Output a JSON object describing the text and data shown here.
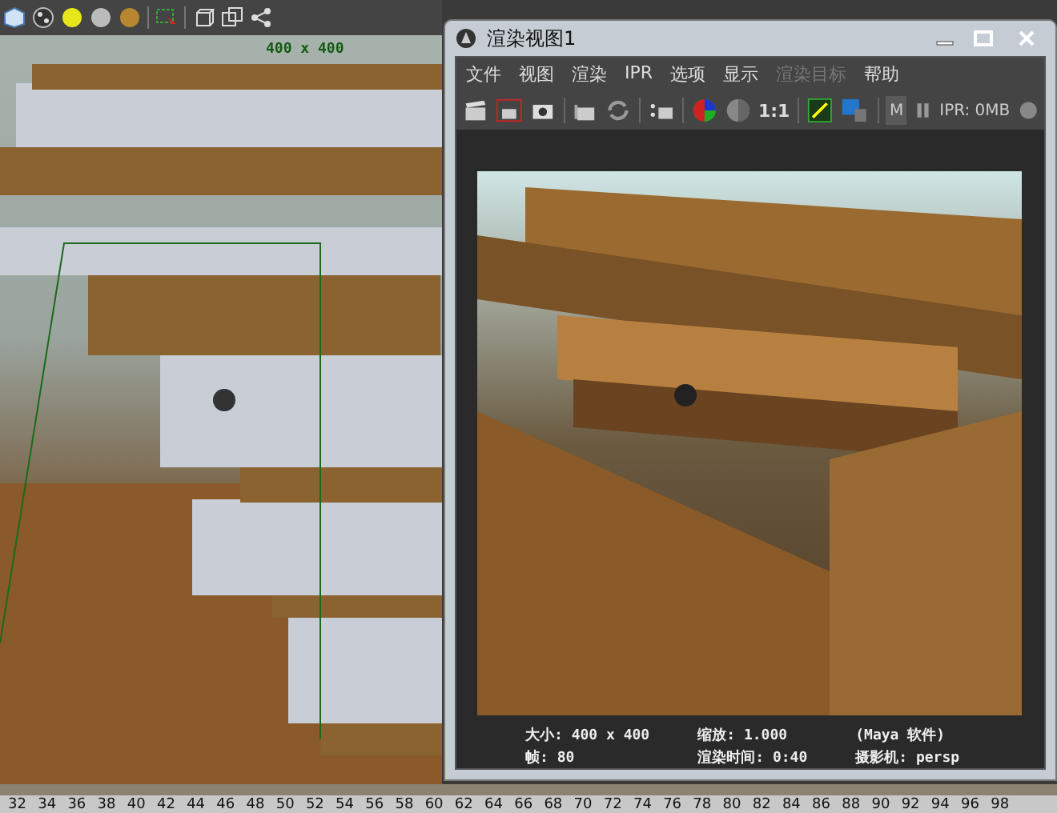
{
  "viewport": {
    "resolution_label": "400 x 400"
  },
  "render_view": {
    "title": "渲染视图1",
    "menu": [
      {
        "label": "文件",
        "disabled": false
      },
      {
        "label": "视图",
        "disabled": false
      },
      {
        "label": "渲染",
        "disabled": false
      },
      {
        "label": "IPR",
        "disabled": false
      },
      {
        "label": "选项",
        "disabled": false
      },
      {
        "label": "显示",
        "disabled": false
      },
      {
        "label": "渲染目标",
        "disabled": true
      },
      {
        "label": "帮助",
        "disabled": false
      }
    ],
    "toolbar": {
      "ratio_label": "1:1",
      "ipr_toggle": "M",
      "ipr_memory": "IPR: 0MB"
    },
    "info": {
      "size": "大小: 400 x 400",
      "zoom": "缩放: 1.000",
      "renderer": "(Maya 软件)",
      "frame": "帧: 80",
      "render_time": "渲染时间: 0:40",
      "camera": "摄影机: persp"
    }
  },
  "timeline": {
    "ticks": [
      "32",
      "34",
      "36",
      "38",
      "40",
      "42",
      "44",
      "46",
      "48",
      "50",
      "52",
      "54",
      "56",
      "58",
      "60",
      "62",
      "64",
      "66",
      "68",
      "70",
      "72",
      "74",
      "76",
      "78",
      "80",
      "82",
      "84",
      "86",
      "88",
      "90",
      "92",
      "94",
      "96",
      "98"
    ]
  }
}
